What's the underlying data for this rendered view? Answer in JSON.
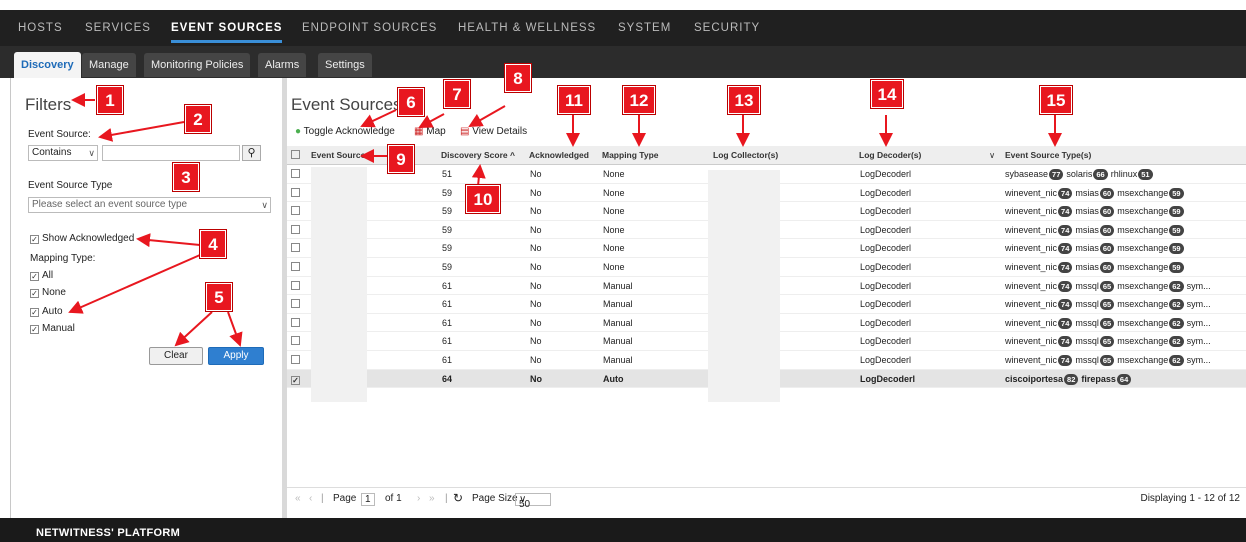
{
  "topnav": [
    "HOSTS",
    "SERVICES",
    "EVENT SOURCES",
    "ENDPOINT SOURCES",
    "HEALTH & WELLNESS",
    "SYSTEM",
    "SECURITY"
  ],
  "subtabs": [
    "Discovery",
    "Manage",
    "Monitoring Policies",
    "Alarms",
    "Settings"
  ],
  "filters": {
    "title": "Filters",
    "event_source_label": "Event Source:",
    "match_select": "Contains",
    "event_source_value": "",
    "type_label": "Event Source Type",
    "type_placeholder": "Please select an event source type",
    "show_ack": "Show Acknowledged",
    "mapping_label": "Mapping Type:",
    "mapping_options": [
      "All",
      "None",
      "Auto",
      "Manual"
    ],
    "clear": "Clear",
    "apply": "Apply"
  },
  "pane": {
    "title": "Event Sources",
    "toggle_ack": "Toggle Acknowledge",
    "map": "Map",
    "view_details": "View Details"
  },
  "columns": [
    "Event Source",
    "Discovery Score ^",
    "Acknowledged",
    "Mapping Type",
    "Log Collector(s)",
    "Log Decoder(s)",
    "Event Source Type(s)"
  ],
  "rows": [
    {
      "score": "51",
      "ack": "No",
      "mapping": "None",
      "decoder": "LogDecoderl",
      "types": [
        [
          "sybasease",
          "77"
        ],
        [
          "solaris",
          "66"
        ],
        [
          "rhlinux",
          "51"
        ]
      ],
      "checked": false
    },
    {
      "score": "59",
      "ack": "No",
      "mapping": "None",
      "decoder": "LogDecoderl",
      "types": [
        [
          "winevent_nic",
          "74"
        ],
        [
          "msias",
          "60"
        ],
        [
          "msexchange",
          "59"
        ]
      ],
      "checked": false
    },
    {
      "score": "59",
      "ack": "No",
      "mapping": "None",
      "decoder": "LogDecoderl",
      "types": [
        [
          "winevent_nic",
          "74"
        ],
        [
          "msias",
          "60"
        ],
        [
          "msexchange",
          "59"
        ]
      ],
      "checked": false
    },
    {
      "score": "59",
      "ack": "No",
      "mapping": "None",
      "decoder": "LogDecoderl",
      "types": [
        [
          "winevent_nic",
          "74"
        ],
        [
          "msias",
          "60"
        ],
        [
          "msexchange",
          "59"
        ]
      ],
      "checked": false
    },
    {
      "score": "59",
      "ack": "No",
      "mapping": "None",
      "decoder": "LogDecoderl",
      "types": [
        [
          "winevent_nic",
          "74"
        ],
        [
          "msias",
          "60"
        ],
        [
          "msexchange",
          "59"
        ]
      ],
      "checked": false
    },
    {
      "score": "59",
      "ack": "No",
      "mapping": "None",
      "decoder": "LogDecoderl",
      "types": [
        [
          "winevent_nic",
          "74"
        ],
        [
          "msias",
          "60"
        ],
        [
          "msexchange",
          "59"
        ]
      ],
      "checked": false
    },
    {
      "score": "61",
      "ack": "No",
      "mapping": "Manual",
      "decoder": "LogDecoderl",
      "types": [
        [
          "winevent_nic",
          "74"
        ],
        [
          "mssql",
          "65"
        ],
        [
          "msexchange",
          "62"
        ]
      ],
      "more": "sym...",
      "checked": false
    },
    {
      "score": "61",
      "ack": "No",
      "mapping": "Manual",
      "decoder": "LogDecoderl",
      "types": [
        [
          "winevent_nic",
          "74"
        ],
        [
          "mssql",
          "65"
        ],
        [
          "msexchange",
          "62"
        ]
      ],
      "more": "sym...",
      "checked": false
    },
    {
      "score": "61",
      "ack": "No",
      "mapping": "Manual",
      "decoder": "LogDecoderl",
      "types": [
        [
          "winevent_nic",
          "74"
        ],
        [
          "mssql",
          "65"
        ],
        [
          "msexchange",
          "62"
        ]
      ],
      "more": "sym...",
      "checked": false
    },
    {
      "score": "61",
      "ack": "No",
      "mapping": "Manual",
      "decoder": "LogDecoderl",
      "types": [
        [
          "winevent_nic",
          "74"
        ],
        [
          "mssql",
          "65"
        ],
        [
          "msexchange",
          "62"
        ]
      ],
      "more": "sym...",
      "checked": false
    },
    {
      "score": "61",
      "ack": "No",
      "mapping": "Manual",
      "decoder": "LogDecoderl",
      "types": [
        [
          "winevent_nic",
          "74"
        ],
        [
          "mssql",
          "65"
        ],
        [
          "msexchange",
          "62"
        ]
      ],
      "more": "sym...",
      "checked": false
    },
    {
      "score": "64",
      "ack": "No",
      "mapping": "Auto",
      "decoder": "LogDecoderl",
      "types": [
        [
          "ciscoiportesa",
          "82"
        ],
        [
          "firepass",
          "64"
        ]
      ],
      "checked": true
    }
  ],
  "pager": {
    "page_label": "Page",
    "page": "1",
    "of": "of 1",
    "page_size_label": "Page Size",
    "page_size": "50",
    "display": "Displaying 1 - 12 of 12"
  },
  "footer": {
    "brand": "NETWITNESS' PLATFORM"
  },
  "callouts": [
    "1",
    "2",
    "3",
    "4",
    "5",
    "6",
    "7",
    "8",
    "9",
    "10",
    "11",
    "12",
    "13",
    "14",
    "15"
  ],
  "colors": {
    "accent": "#1e6bb8",
    "callout": "#e8171f",
    "nav_bg": "#202020"
  },
  "icons": [
    "search-icon",
    "toggle-acknowledge-icon",
    "map-icon",
    "view-details-icon",
    "refresh-icon"
  ]
}
